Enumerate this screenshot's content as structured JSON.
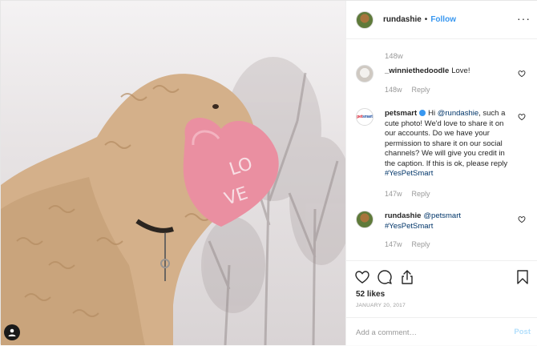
{
  "header": {
    "username": "rundashie",
    "separator": "•",
    "follow_label": "Follow",
    "more_icon": "more-options-icon"
  },
  "comments": {
    "previous_age": "148w",
    "items": [
      {
        "username": "_winniethedoodle",
        "text": "Love!",
        "age": "148w",
        "reply_label": "Reply"
      },
      {
        "username": "petsmart",
        "verified": true,
        "text_parts": [
          "Hi ",
          "@rundashie",
          ", such a cute photo! We'd love to share it on our accounts. Do we have your permission to share it on our social channels? We will give you credit in the caption. If this is ok, please reply ",
          "#YesPetSmart"
        ],
        "age": "147w",
        "reply_label": "Reply",
        "avatar_text": [
          "pet",
          "smart"
        ]
      },
      {
        "username": "rundashie",
        "text_parts": [
          "@petsmart",
          "#YesPetSmart"
        ],
        "age": "147w",
        "reply_label": "Reply"
      }
    ]
  },
  "actions": {
    "likes": "52 likes",
    "date": "JANUARY 20, 2017"
  },
  "add_comment": {
    "placeholder": "Add a comment…",
    "post_label": "Post"
  },
  "colors": {
    "link_blue": "#3897f0",
    "mention_navy": "#003569",
    "post_disabled": "#b2dffc",
    "muted": "#999999"
  }
}
